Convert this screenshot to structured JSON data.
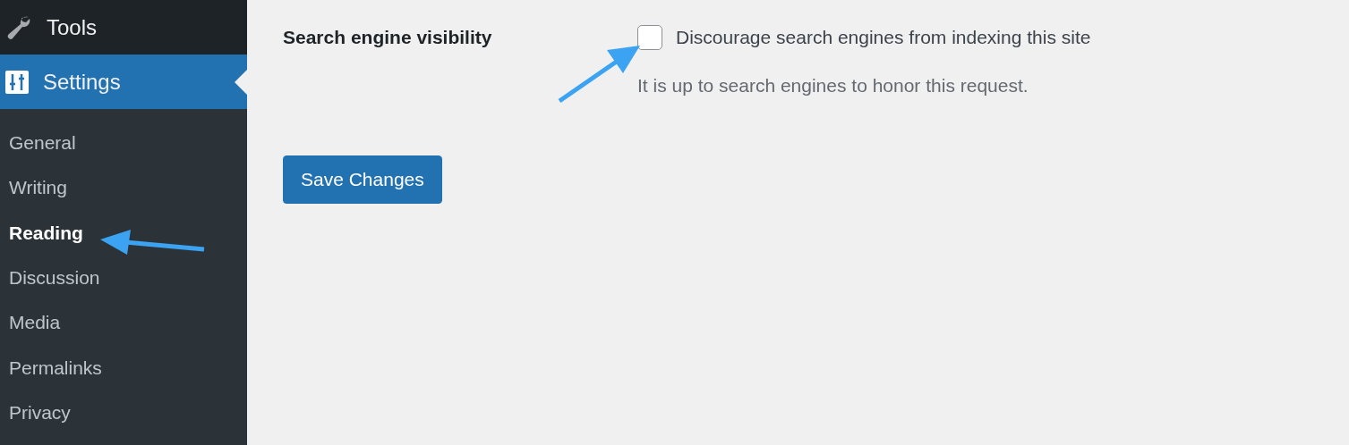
{
  "sidebar": {
    "menu": [
      {
        "label": "Tools",
        "kind": "tools",
        "selected": false
      },
      {
        "label": "Settings",
        "kind": "settings",
        "selected": true
      }
    ],
    "submenu": [
      {
        "label": "General",
        "selected": false
      },
      {
        "label": "Writing",
        "selected": false
      },
      {
        "label": "Reading",
        "selected": true
      },
      {
        "label": "Discussion",
        "selected": false
      },
      {
        "label": "Media",
        "selected": false
      },
      {
        "label": "Permalinks",
        "selected": false
      },
      {
        "label": "Privacy",
        "selected": false
      }
    ]
  },
  "settings": {
    "label": "Search engine visibility",
    "checkbox": {
      "label": "Discourage search engines from indexing this site",
      "checked": false
    },
    "description": "It is up to search engines to honor this request."
  },
  "save_button": "Save Changes"
}
